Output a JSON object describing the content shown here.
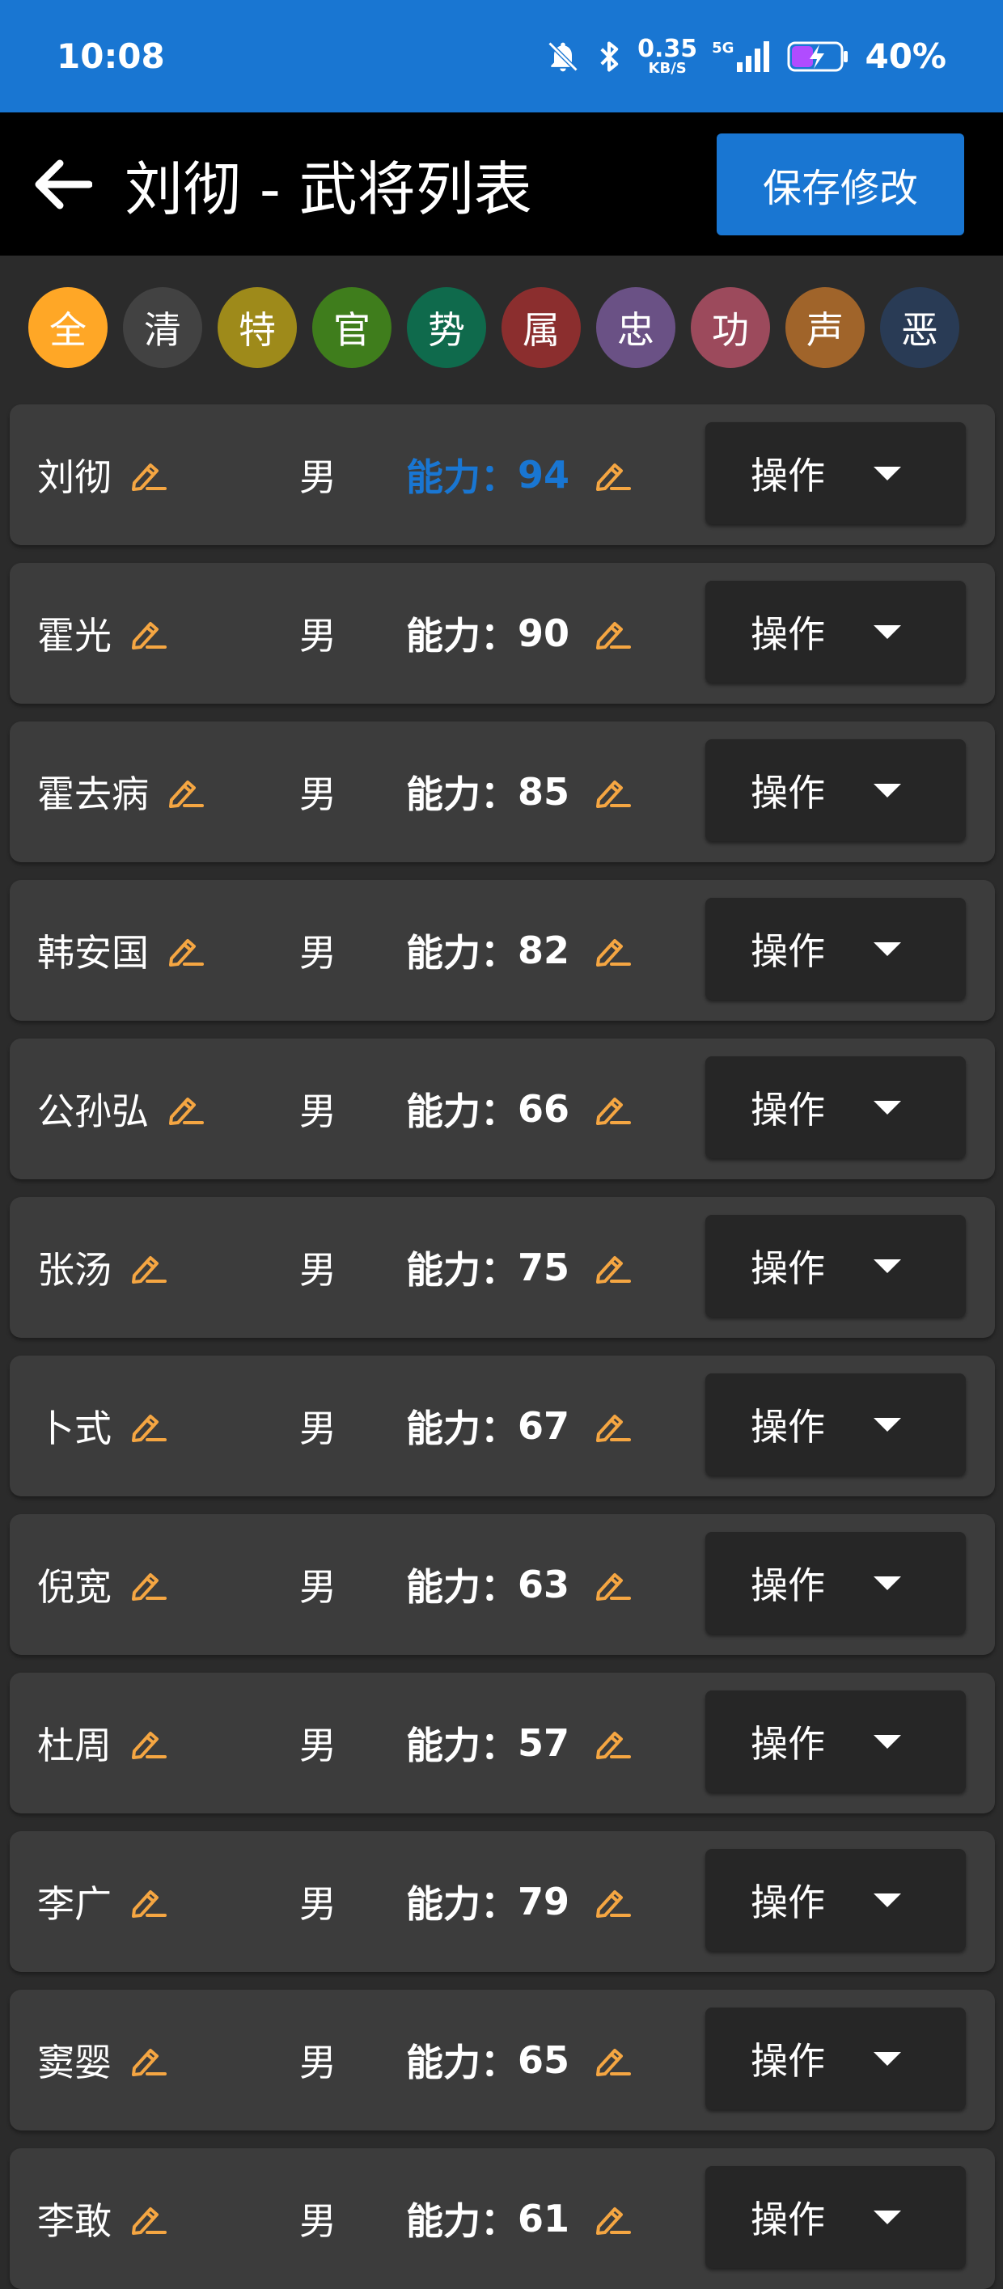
{
  "status_bar": {
    "time": "10:08",
    "net_speed_value": "0.35",
    "net_speed_unit": "KB/S",
    "network_type": "5G",
    "battery_percent": "40%",
    "icons": [
      "mute-bell-icon",
      "bluetooth-icon",
      "signal-icon",
      "battery-charging-icon"
    ]
  },
  "app_bar": {
    "title": "刘彻 - 武将列表",
    "save_label": "保存修改",
    "back_icon": "arrow-left-icon"
  },
  "filters": [
    {
      "label": "全",
      "color": "#ffa726"
    },
    {
      "label": "清",
      "color": "#424242"
    },
    {
      "label": "特",
      "color": "#9e8a1a"
    },
    {
      "label": "官",
      "color": "#3f7d1c"
    },
    {
      "label": "势",
      "color": "#0f6a4c"
    },
    {
      "label": "属",
      "color": "#8b2e2e"
    },
    {
      "label": "忠",
      "color": "#6a5185"
    },
    {
      "label": "功",
      "color": "#9c4a5c"
    },
    {
      "label": "声",
      "color": "#a0642a"
    },
    {
      "label": "恶",
      "color": "#293b55"
    }
  ],
  "generals": [
    {
      "name": "刘彻",
      "gender": "男",
      "ability_label": "能力：",
      "ability": "94",
      "highlight": true,
      "op_label": "操作"
    },
    {
      "name": "霍光",
      "gender": "男",
      "ability_label": "能力：",
      "ability": "90",
      "highlight": false,
      "op_label": "操作"
    },
    {
      "name": "霍去病",
      "gender": "男",
      "ability_label": "能力：",
      "ability": "85",
      "highlight": false,
      "op_label": "操作"
    },
    {
      "name": "韩安国",
      "gender": "男",
      "ability_label": "能力：",
      "ability": "82",
      "highlight": false,
      "op_label": "操作"
    },
    {
      "name": "公孙弘",
      "gender": "男",
      "ability_label": "能力：",
      "ability": "66",
      "highlight": false,
      "op_label": "操作"
    },
    {
      "name": "张汤",
      "gender": "男",
      "ability_label": "能力：",
      "ability": "75",
      "highlight": false,
      "op_label": "操作"
    },
    {
      "name": "卜式",
      "gender": "男",
      "ability_label": "能力：",
      "ability": "67",
      "highlight": false,
      "op_label": "操作"
    },
    {
      "name": "倪宽",
      "gender": "男",
      "ability_label": "能力：",
      "ability": "63",
      "highlight": false,
      "op_label": "操作"
    },
    {
      "name": "杜周",
      "gender": "男",
      "ability_label": "能力：",
      "ability": "57",
      "highlight": false,
      "op_label": "操作"
    },
    {
      "name": "李广",
      "gender": "男",
      "ability_label": "能力：",
      "ability": "79",
      "highlight": false,
      "op_label": "操作"
    },
    {
      "name": "窦婴",
      "gender": "男",
      "ability_label": "能力：",
      "ability": "65",
      "highlight": false,
      "op_label": "操作"
    },
    {
      "name": "李敢",
      "gender": "男",
      "ability_label": "能力：",
      "ability": "61",
      "highlight": false,
      "op_label": "操作"
    }
  ],
  "colors": {
    "accent": "#1976d2",
    "edit_icon": "#f5a642",
    "row_bg": "#3c3c3c",
    "page_bg": "#2b2b2b"
  }
}
